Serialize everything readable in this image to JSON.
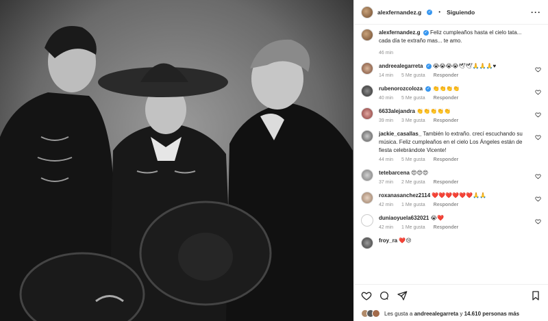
{
  "header": {
    "username": "alexfernandez.g",
    "follow_state": "Siguiendo",
    "more_icon": "more-horizontal-icon"
  },
  "caption": {
    "username": "alexfernandez.g",
    "text": "Feliz cumpleaños hasta el cielo tata... cada día te extraño mas... te amo.",
    "time": "46 min"
  },
  "comments": [
    {
      "user": "andreealegarreta",
      "text": "😭😭😭😭🕊🕊🙏🙏🙏♥",
      "time": "14 min",
      "likes": "5 Me gusta",
      "reply": "Responder"
    },
    {
      "user": "rubenorozcoloza",
      "text": "👏👏👏👏",
      "time": "40 min",
      "likes": "5 Me gusta",
      "reply": "Responder"
    },
    {
      "user": "6633alejandra",
      "text": "👏👏👏👏👏",
      "time": "39 min",
      "likes": "3 Me gusta",
      "reply": "Responder"
    },
    {
      "user": "jackie_casallas_",
      "text": "También lo extraño. crecí escuchando su música. Feliz cumpleaños en el cielo Los Ángeles están de fiesta celebrándote Vicente!",
      "time": "44 min",
      "likes": "5 Me gusta",
      "reply": "Responder"
    },
    {
      "user": "tetebarcena",
      "text": "😍😍😍",
      "time": "37 min",
      "likes": "2 Me gusta",
      "reply": "Responder"
    },
    {
      "user": "roxanasanchez2114",
      "text": "❤️❤️❤️❤️❤️❤️🙏🙏",
      "time": "42 min",
      "likes": "1 Me gusta",
      "reply": "Responder"
    },
    {
      "user": "duniaoyuela632021",
      "text": "😭❤️",
      "time": "42 min",
      "likes": "1 Me gusta",
      "reply": "Responder"
    },
    {
      "user": "froy_ra",
      "text": "❤️😢",
      "time": "",
      "likes": "",
      "reply": ""
    }
  ],
  "likes_line": {
    "prefix": "Les gusta a",
    "user": "andreealegarreta",
    "middle": "y",
    "count": "14.610 personas más"
  },
  "colors": {
    "verified": "#3897f0",
    "muted": "#8e8e8e",
    "text": "#262626"
  }
}
